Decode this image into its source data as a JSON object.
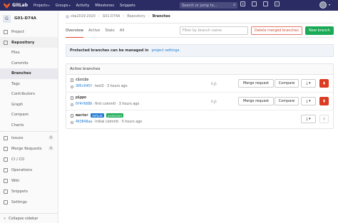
{
  "topbar": {
    "app_name": "GitLab",
    "nav": [
      "Projects",
      "Groups",
      "Activity",
      "Milestones",
      "Snippets"
    ],
    "search_placeholder": "Search or jump to..."
  },
  "sidebar": {
    "project_initial": "G",
    "project_name": "G01-D74A",
    "items": [
      {
        "label": "Project"
      },
      {
        "label": "Repository"
      },
      {
        "label": "Issues",
        "count": "0"
      },
      {
        "label": "Merge Requests",
        "count": "0"
      },
      {
        "label": "CI / CD"
      },
      {
        "label": "Operations"
      },
      {
        "label": "Wiki"
      },
      {
        "label": "Snippets"
      },
      {
        "label": "Settings"
      }
    ],
    "repo_subitems": [
      "Files",
      "Commits",
      "Branches",
      "Tags",
      "Contributors",
      "Graph",
      "Compare",
      "Charts"
    ],
    "collapse_label": "Collapse sidebar"
  },
  "breadcrumb": {
    "group": "cba2019-2020",
    "project": "G01-D74A",
    "section": "Repository",
    "current": "Branches"
  },
  "tabs": [
    "Overview",
    "Active",
    "Stale",
    "All"
  ],
  "filter_placeholder": "Filter by branch name",
  "delete_merged_label": "Delete merged branches",
  "new_branch_label": "New branch",
  "info": {
    "text": "Protected branches can be managed in",
    "link": "project settings."
  },
  "panel_title": "Active branches",
  "branches": [
    {
      "name": "ciccio",
      "sha": "305c045f",
      "message": "test3",
      "time": "3 hours ago",
      "behind": "0",
      "ahead": "1"
    },
    {
      "name": "pippo",
      "sha": "0f4f6686",
      "message": "first commit",
      "time": "3 hours ago",
      "behind": "0",
      "ahead": "1"
    },
    {
      "name": "master",
      "sha": "463848aa",
      "message": "Initial commit",
      "time": "5 hours ago",
      "badges": [
        "default",
        "protected"
      ]
    }
  ],
  "row_buttons": {
    "merge_request": "Merge request",
    "compare": "Compare"
  }
}
